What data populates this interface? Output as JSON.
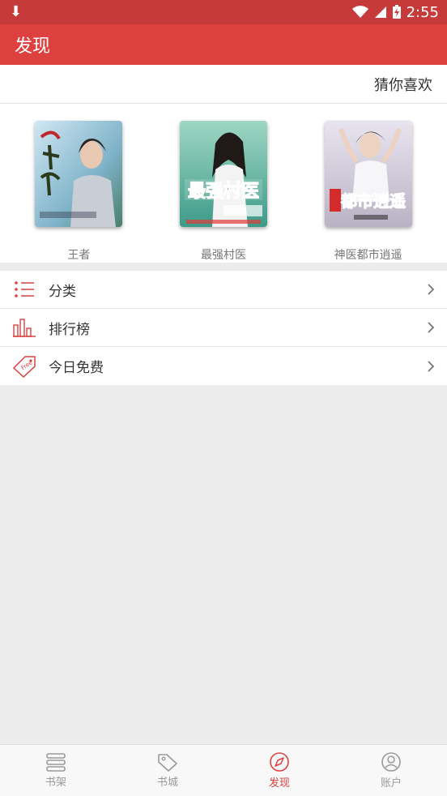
{
  "status_bar": {
    "time": "2:55"
  },
  "app_bar": {
    "title": "发现"
  },
  "recommend": {
    "header": "猜你喜欢",
    "books": [
      {
        "title": "王者"
      },
      {
        "title": "最强村医"
      },
      {
        "title": "神医都市逍遥"
      }
    ]
  },
  "menu": [
    {
      "label": "分类",
      "icon": "list-icon"
    },
    {
      "label": "排行榜",
      "icon": "bar-chart-icon"
    },
    {
      "label": "今日免费",
      "icon": "free-tag-icon"
    }
  ],
  "tabs": [
    {
      "label": "书架",
      "icon": "bookshelf-icon",
      "active": false
    },
    {
      "label": "书城",
      "icon": "tag-icon",
      "active": false
    },
    {
      "label": "发现",
      "icon": "compass-icon",
      "active": true
    },
    {
      "label": "账户",
      "icon": "user-icon",
      "active": false
    }
  ],
  "colors": {
    "accent": "#dc4140",
    "status_bar": "#c73a3a",
    "background": "#ececec"
  }
}
